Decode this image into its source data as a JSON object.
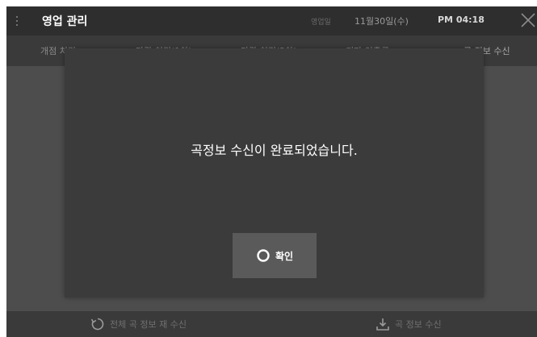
{
  "header": {
    "title": "영업 관리",
    "business_date_label": "영업일",
    "date": "11월30일(수)",
    "time": "PM 04:18"
  },
  "tabs": [
    {
      "label": "개점 처리"
    },
    {
      "label": "마감 처리(1차)"
    },
    {
      "label": "마감 처리(2차)"
    },
    {
      "label": "키마 인출금"
    },
    {
      "label": "곡 정보 수신"
    }
  ],
  "modal": {
    "message": "곡정보 수신이 완료되었습니다.",
    "confirm_label": "확인"
  },
  "bottom": {
    "refetch_all_label": "전체 곡 정보 재 수신",
    "receive_label": "곡 정보 수신"
  },
  "colors": {
    "header_bg": "#2e2e2e",
    "modal_bg": "#3b3b3b",
    "button_bg": "#5a5a5a",
    "text_primary": "#ffffff"
  },
  "icons": {
    "menu": "kebab-menu-icon",
    "close": "close-icon",
    "confirm": "ring-icon",
    "refresh": "refresh-icon",
    "download": "download-icon"
  }
}
